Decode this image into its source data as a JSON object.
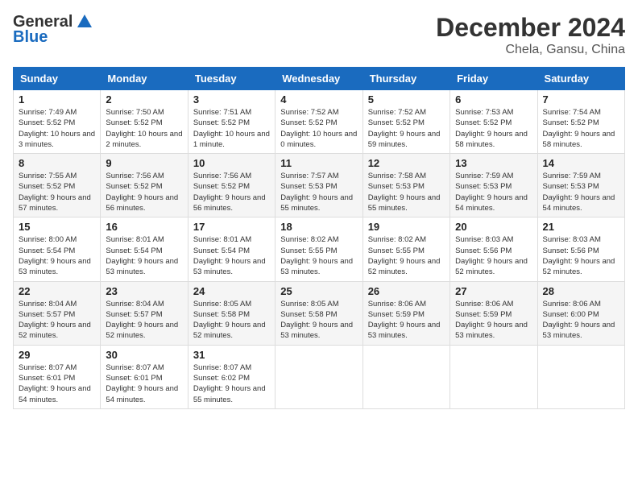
{
  "logo": {
    "general": "General",
    "blue": "Blue"
  },
  "title": "December 2024",
  "location": "Chela, Gansu, China",
  "days_header": [
    "Sunday",
    "Monday",
    "Tuesday",
    "Wednesday",
    "Thursday",
    "Friday",
    "Saturday"
  ],
  "weeks": [
    [
      {
        "day": "1",
        "sunrise": "7:49 AM",
        "sunset": "5:52 PM",
        "daylight": "10 hours and 3 minutes."
      },
      {
        "day": "2",
        "sunrise": "7:50 AM",
        "sunset": "5:52 PM",
        "daylight": "10 hours and 2 minutes."
      },
      {
        "day": "3",
        "sunrise": "7:51 AM",
        "sunset": "5:52 PM",
        "daylight": "10 hours and 1 minute."
      },
      {
        "day": "4",
        "sunrise": "7:52 AM",
        "sunset": "5:52 PM",
        "daylight": "10 hours and 0 minutes."
      },
      {
        "day": "5",
        "sunrise": "7:52 AM",
        "sunset": "5:52 PM",
        "daylight": "9 hours and 59 minutes."
      },
      {
        "day": "6",
        "sunrise": "7:53 AM",
        "sunset": "5:52 PM",
        "daylight": "9 hours and 58 minutes."
      },
      {
        "day": "7",
        "sunrise": "7:54 AM",
        "sunset": "5:52 PM",
        "daylight": "9 hours and 58 minutes."
      }
    ],
    [
      {
        "day": "8",
        "sunrise": "7:55 AM",
        "sunset": "5:52 PM",
        "daylight": "9 hours and 57 minutes."
      },
      {
        "day": "9",
        "sunrise": "7:56 AM",
        "sunset": "5:52 PM",
        "daylight": "9 hours and 56 minutes."
      },
      {
        "day": "10",
        "sunrise": "7:56 AM",
        "sunset": "5:52 PM",
        "daylight": "9 hours and 56 minutes."
      },
      {
        "day": "11",
        "sunrise": "7:57 AM",
        "sunset": "5:53 PM",
        "daylight": "9 hours and 55 minutes."
      },
      {
        "day": "12",
        "sunrise": "7:58 AM",
        "sunset": "5:53 PM",
        "daylight": "9 hours and 55 minutes."
      },
      {
        "day": "13",
        "sunrise": "7:59 AM",
        "sunset": "5:53 PM",
        "daylight": "9 hours and 54 minutes."
      },
      {
        "day": "14",
        "sunrise": "7:59 AM",
        "sunset": "5:53 PM",
        "daylight": "9 hours and 54 minutes."
      }
    ],
    [
      {
        "day": "15",
        "sunrise": "8:00 AM",
        "sunset": "5:54 PM",
        "daylight": "9 hours and 53 minutes."
      },
      {
        "day": "16",
        "sunrise": "8:01 AM",
        "sunset": "5:54 PM",
        "daylight": "9 hours and 53 minutes."
      },
      {
        "day": "17",
        "sunrise": "8:01 AM",
        "sunset": "5:54 PM",
        "daylight": "9 hours and 53 minutes."
      },
      {
        "day": "18",
        "sunrise": "8:02 AM",
        "sunset": "5:55 PM",
        "daylight": "9 hours and 53 minutes."
      },
      {
        "day": "19",
        "sunrise": "8:02 AM",
        "sunset": "5:55 PM",
        "daylight": "9 hours and 52 minutes."
      },
      {
        "day": "20",
        "sunrise": "8:03 AM",
        "sunset": "5:56 PM",
        "daylight": "9 hours and 52 minutes."
      },
      {
        "day": "21",
        "sunrise": "8:03 AM",
        "sunset": "5:56 PM",
        "daylight": "9 hours and 52 minutes."
      }
    ],
    [
      {
        "day": "22",
        "sunrise": "8:04 AM",
        "sunset": "5:57 PM",
        "daylight": "9 hours and 52 minutes."
      },
      {
        "day": "23",
        "sunrise": "8:04 AM",
        "sunset": "5:57 PM",
        "daylight": "9 hours and 52 minutes."
      },
      {
        "day": "24",
        "sunrise": "8:05 AM",
        "sunset": "5:58 PM",
        "daylight": "9 hours and 52 minutes."
      },
      {
        "day": "25",
        "sunrise": "8:05 AM",
        "sunset": "5:58 PM",
        "daylight": "9 hours and 53 minutes."
      },
      {
        "day": "26",
        "sunrise": "8:06 AM",
        "sunset": "5:59 PM",
        "daylight": "9 hours and 53 minutes."
      },
      {
        "day": "27",
        "sunrise": "8:06 AM",
        "sunset": "5:59 PM",
        "daylight": "9 hours and 53 minutes."
      },
      {
        "day": "28",
        "sunrise": "8:06 AM",
        "sunset": "6:00 PM",
        "daylight": "9 hours and 53 minutes."
      }
    ],
    [
      {
        "day": "29",
        "sunrise": "8:07 AM",
        "sunset": "6:01 PM",
        "daylight": "9 hours and 54 minutes."
      },
      {
        "day": "30",
        "sunrise": "8:07 AM",
        "sunset": "6:01 PM",
        "daylight": "9 hours and 54 minutes."
      },
      {
        "day": "31",
        "sunrise": "8:07 AM",
        "sunset": "6:02 PM",
        "daylight": "9 hours and 55 minutes."
      },
      null,
      null,
      null,
      null
    ]
  ]
}
